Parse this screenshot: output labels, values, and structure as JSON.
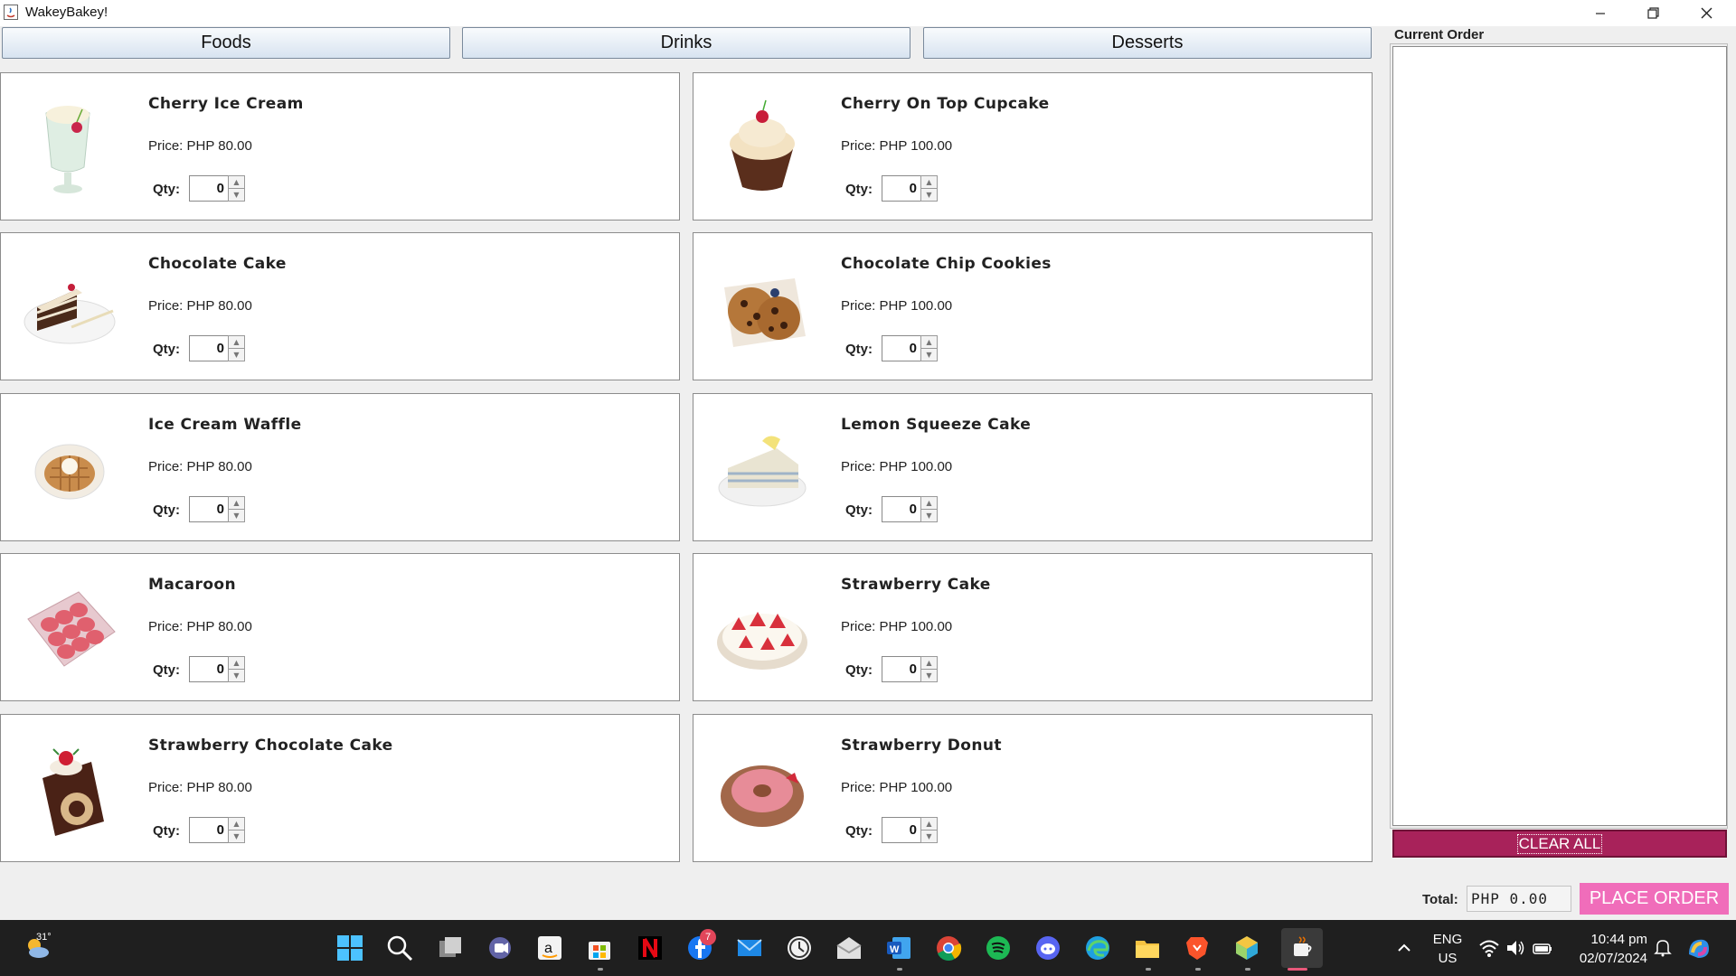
{
  "window": {
    "title": "WakeyBakey!"
  },
  "categories": [
    "Foods",
    "Drinks",
    "Desserts"
  ],
  "items": [
    {
      "name": "Cherry Ice Cream",
      "price": "Price: PHP 80.00",
      "qty_label": "Qty:",
      "qty": "0"
    },
    {
      "name": "Cherry On Top Cupcake",
      "price": "Price: PHP 100.00",
      "qty_label": "Qty:",
      "qty": "0"
    },
    {
      "name": "Chocolate Cake",
      "price": "Price: PHP 80.00",
      "qty_label": "Qty:",
      "qty": "0"
    },
    {
      "name": "Chocolate Chip Cookies",
      "price": "Price: PHP 100.00",
      "qty_label": "Qty:",
      "qty": "0"
    },
    {
      "name": "Ice Cream Waffle",
      "price": "Price: PHP 80.00",
      "qty_label": "Qty:",
      "qty": "0"
    },
    {
      "name": "Lemon Squeeze Cake",
      "price": "Price: PHP 100.00",
      "qty_label": "Qty:",
      "qty": "0"
    },
    {
      "name": "Macaroon",
      "price": "Price: PHP 80.00",
      "qty_label": "Qty:",
      "qty": "0"
    },
    {
      "name": "Strawberry Cake",
      "price": "Price: PHP 100.00",
      "qty_label": "Qty:",
      "qty": "0"
    },
    {
      "name": "Strawberry Chocolate Cake",
      "price": "Price: PHP 80.00",
      "qty_label": "Qty:",
      "qty": "0"
    },
    {
      "name": "Strawberry Donut",
      "price": "Price: PHP 100.00",
      "qty_label": "Qty:",
      "qty": "0"
    }
  ],
  "order": {
    "title": "Current Order",
    "clear_label": "CLEAR ALL",
    "total_label": "Total:",
    "total_value": "PHP 0.00",
    "place_label": "PLACE ORDER"
  },
  "colors": {
    "clear_button": "#a8225a",
    "place_button": "#f06dba",
    "taskbar": "#1f1f1f"
  },
  "taskbar": {
    "weather_temp": "31°",
    "notification_count": "7",
    "lang": "ENG",
    "region": "US",
    "time": "10:44 pm",
    "date": "02/07/2024",
    "icons": [
      "weather-icon",
      "start-icon",
      "search-icon",
      "task-view-icon",
      "teams-icon",
      "amazon-icon",
      "store-icon",
      "netflix-icon",
      "facebook-icon",
      "mail-icon",
      "clock-icon",
      "mail-alt-icon",
      "word-icon",
      "chrome-icon",
      "spotify-icon",
      "discord-icon",
      "edge-icon",
      "file-explorer-icon",
      "brave-icon",
      "app-icon",
      "java-icon"
    ]
  }
}
